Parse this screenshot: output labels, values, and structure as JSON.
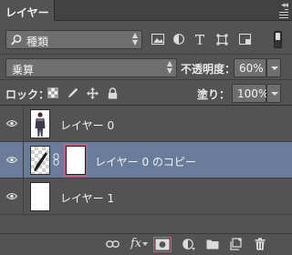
{
  "panel": {
    "tab_label": "レイヤー",
    "collapse_glyph": "◂◂"
  },
  "filter": {
    "kind_label": "種類",
    "icons": [
      "image-filter-icon",
      "adjustment-filter-icon",
      "type-filter-icon",
      "shape-filter-icon",
      "smartobject-filter-icon"
    ]
  },
  "blend": {
    "mode": "乗算",
    "opacity_label": "不透明度：",
    "opacity_value": "60%"
  },
  "lock": {
    "label": "ロック：",
    "icons": [
      "lock-transparent-pixels-icon",
      "lock-image-pixels-icon",
      "lock-position-icon",
      "lock-all-icon"
    ],
    "fill_label": "塗り：",
    "fill_value": "100%"
  },
  "layers": [
    {
      "name": "レイヤー 0",
      "visible": true,
      "selected": false,
      "thumb": "photo"
    },
    {
      "name": "レイヤー 0 のコピー",
      "visible": true,
      "selected": true,
      "thumb": "checker",
      "has_mask": true
    },
    {
      "name": "レイヤー 1",
      "visible": true,
      "selected": false,
      "thumb": "white"
    }
  ],
  "toolbar": {
    "fx_label": "fx",
    "icons": [
      "link-layers-icon",
      "layer-style-icon",
      "add-mask-icon",
      "adjustment-layer-icon",
      "new-group-icon",
      "new-layer-icon",
      "delete-layer-icon"
    ],
    "active": "add-mask-icon"
  },
  "colors": {
    "panel_bg": "#535353",
    "selected_row": "#697c99",
    "mask_outline": "#c86480"
  }
}
